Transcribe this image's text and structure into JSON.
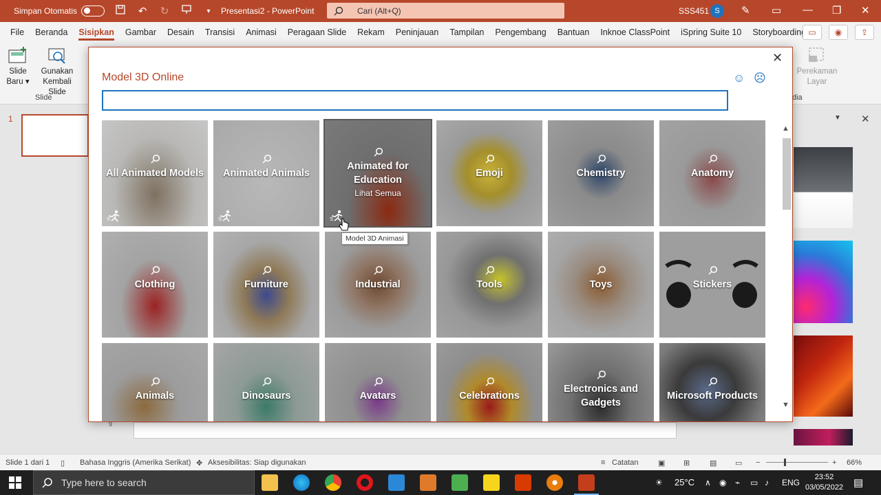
{
  "titlebar": {
    "autosave_label": "Simpan Otomatis",
    "doc_title": "Presentasi2  -  PowerPoint",
    "search_placeholder": "Cari (Alt+Q)",
    "user_name": "SSS451",
    "user_initial": "S"
  },
  "tabs": [
    "File",
    "Beranda",
    "Sisipkan",
    "Gambar",
    "Desain",
    "Transisi",
    "Animasi",
    "Peragaan Slide",
    "Rekam",
    "Peninjauan",
    "Tampilan",
    "Pengembang",
    "Bantuan",
    "Inknoe ClassPoint",
    "iSpring Suite 10",
    "Storyboarding"
  ],
  "active_tab": "Sisipkan",
  "ribbon": {
    "new_slide_line1": "Slide",
    "new_slide_line2": "Baru",
    "reuse_line1": "Gunakan",
    "reuse_line2": "Kembali Slide",
    "group_slide": "Slide",
    "screen_rec_line1": "Perekaman",
    "screen_rec_line2": "Layar",
    "group_media_partial": "dia"
  },
  "slides": {
    "number": "1",
    "ruler_mark": "9"
  },
  "dialog": {
    "title": "Model 3D Online",
    "search_value": "",
    "tooltip": "Model 3D Animasi",
    "tiles": [
      {
        "label": "All Animated Models",
        "sub": "",
        "animated": true
      },
      {
        "label": "Animated Animals",
        "sub": "",
        "animated": true
      },
      {
        "label": "Animated for Education",
        "sub": "Lihat Semua",
        "animated": true
      },
      {
        "label": "Emoji",
        "sub": "",
        "animated": false
      },
      {
        "label": "Chemistry",
        "sub": "",
        "animated": false
      },
      {
        "label": "Anatomy",
        "sub": "",
        "animated": false
      },
      {
        "label": "Clothing",
        "sub": "",
        "animated": false
      },
      {
        "label": "Furniture",
        "sub": "",
        "animated": false
      },
      {
        "label": "Industrial",
        "sub": "",
        "animated": false
      },
      {
        "label": "Tools",
        "sub": "",
        "animated": false
      },
      {
        "label": "Toys",
        "sub": "",
        "animated": false
      },
      {
        "label": "Stickers",
        "sub": "",
        "animated": false
      },
      {
        "label": "Animals",
        "sub": "",
        "animated": false
      },
      {
        "label": "Dinosaurs",
        "sub": "",
        "animated": false
      },
      {
        "label": "Avatars",
        "sub": "",
        "animated": false
      },
      {
        "label": "Celebrations",
        "sub": "",
        "animated": false
      },
      {
        "label": "Electronics and Gadgets",
        "sub": "",
        "animated": false
      },
      {
        "label": "Microsoft Products",
        "sub": "",
        "animated": false
      }
    ]
  },
  "status": {
    "slide_of": "Slide 1 dari 1",
    "language": "Bahasa Inggris (Amerika Serikat)",
    "accessibility": "Aksesibilitas: Siap digunakan",
    "notes": "Catatan",
    "zoom": "66%"
  },
  "taskbar": {
    "search_placeholder": "Type here to search",
    "temperature": "25°C",
    "lang": "ENG",
    "time": "23:52",
    "date": "03/05/2022"
  },
  "colors": {
    "accent": "#b7472a",
    "link_blue": "#1e73be"
  }
}
